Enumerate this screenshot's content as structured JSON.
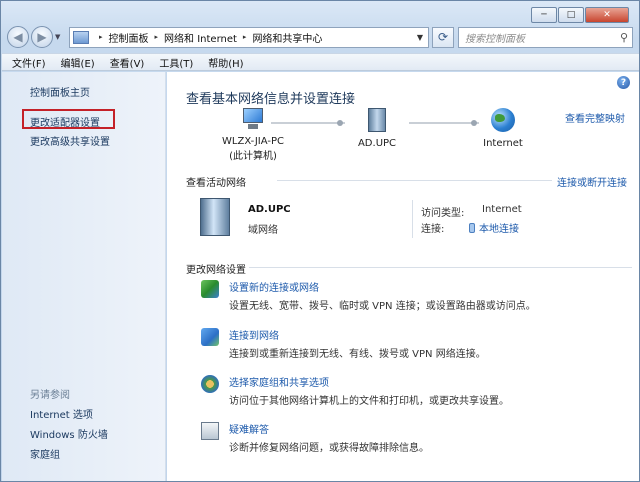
{
  "window": {
    "minimize_glyph": "─",
    "maximize_glyph": "□",
    "close_glyph": "✕"
  },
  "address_bar": {
    "crumbs": [
      "控制面板",
      "网络和 Internet",
      "网络和共享中心"
    ],
    "separator": "▸",
    "search_placeholder": "搜索控制面板"
  },
  "menu": [
    "文件(F)",
    "编辑(E)",
    "查看(V)",
    "工具(T)",
    "帮助(H)"
  ],
  "sidebar": {
    "home": "控制面板主页",
    "items": [
      "更改适配器设置",
      "更改高级共享设置"
    ],
    "see_also_label": "另请参阅",
    "see_also": [
      "Internet 选项",
      "Windows 防火墙",
      "家庭组"
    ]
  },
  "main": {
    "title": "查看基本网络信息并设置连接",
    "full_map_link": "查看完整映射",
    "nodes": [
      {
        "name": "WLZX-JIA-PC",
        "sub": "(此计算机)",
        "icon": "computer-icon"
      },
      {
        "name": "AD.UPC",
        "sub": "",
        "icon": "domain-server-icon"
      },
      {
        "name": "Internet",
        "sub": "",
        "icon": "globe-icon"
      }
    ],
    "active_networks_label": "查看活动网络",
    "connect_disconnect_link": "连接或断开连接",
    "active_network": {
      "name": "AD.UPC",
      "type": "域网络",
      "access_type_label": "访问类型:",
      "access_type_value": "Internet",
      "connections_label": "连接:",
      "connection_value": "本地连接"
    },
    "change_settings_label": "更改网络设置",
    "tasks": [
      {
        "title": "设置新的连接或网络",
        "desc": "设置无线、宽带、拨号、临时或 VPN 连接；或设置路由器或访问点。",
        "icon": "setup-connection-icon"
      },
      {
        "title": "连接到网络",
        "desc": "连接到或重新连接到无线、有线、拨号或 VPN 网络连接。",
        "icon": "connect-network-icon"
      },
      {
        "title": "选择家庭组和共享选项",
        "desc": "访问位于其他网络计算机上的文件和打印机，或更改共享设置。",
        "icon": "homegroup-icon"
      },
      {
        "title": "疑难解答",
        "desc": "诊断并修复网络问题，或获得故障排除信息。",
        "icon": "troubleshoot-icon"
      }
    ]
  },
  "colors": {
    "highlight_box": "#c42128",
    "link": "#1d5aab"
  }
}
